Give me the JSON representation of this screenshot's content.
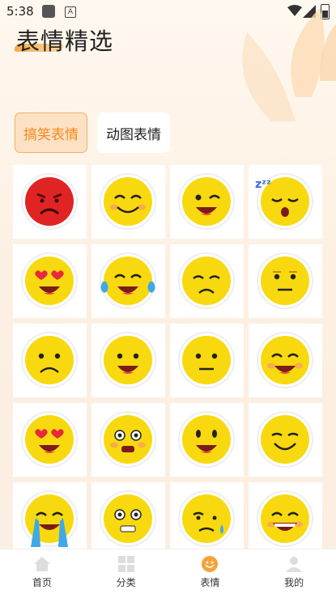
{
  "status_bar": {
    "time": "5:38"
  },
  "header": {
    "title": "表情精选"
  },
  "tabs": [
    {
      "label": "搞笑表情",
      "active": true
    },
    {
      "label": "动图表情",
      "active": false
    }
  ],
  "emojis": [
    "angry-face",
    "smiling-blush-face",
    "winking-face",
    "sleeping-face",
    "heart-eyes-face",
    "laughing-tears-face",
    "sad-face",
    "neutral-face",
    "frowning-face",
    "smiling-face",
    "straight-face",
    "grinning-face",
    "heart-eyes-face",
    "surprised-face",
    "open-smile-face",
    "content-face",
    "crying-face",
    "worried-face",
    "cold-sweat-face",
    "big-grin-face"
  ],
  "bottom_nav": [
    {
      "label": "首页",
      "icon": "home-icon",
      "active": false
    },
    {
      "label": "分类",
      "icon": "grid-icon",
      "active": false
    },
    {
      "label": "表情",
      "icon": "smiley-icon",
      "active": true
    },
    {
      "label": "我的",
      "icon": "user-icon",
      "active": false
    }
  ],
  "colors": {
    "accent": "#f28a1e",
    "emoji_yellow": "#f8d90f",
    "angry_red": "#e02424"
  }
}
